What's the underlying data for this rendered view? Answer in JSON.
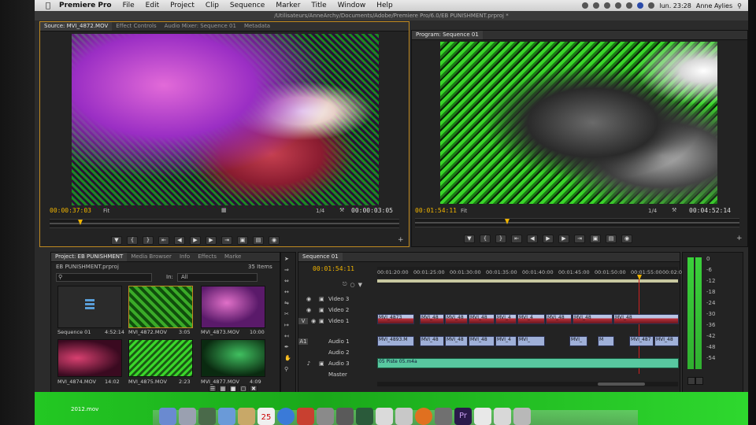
{
  "menubar": {
    "app": "Premiere Pro",
    "items": [
      "File",
      "Edit",
      "Project",
      "Clip",
      "Sequence",
      "Marker",
      "Title",
      "Window",
      "Help"
    ],
    "clock": "lun. 23:28",
    "user": "Anne Aylies"
  },
  "window_title": "/Utilisateurs/AnneArchy/Documents/Adobe/Premiere Pro/6.0/EB PUNISHMENT.prproj *",
  "source": {
    "tabs": [
      "Source: MVI_4872.MOV",
      "Effect Controls",
      "Audio Mixer: Sequence 01",
      "Metadata"
    ],
    "timecode_in": "00:00:37:03",
    "fit": "Fit",
    "res": "1/4",
    "timecode_dur": "00:00:03:05"
  },
  "program": {
    "tab": "Program: Sequence 01",
    "timecode_in": "00:01:54:11",
    "fit": "Fit",
    "res": "1/4",
    "timecode_dur": "00:04:52:14"
  },
  "project": {
    "tabs": [
      "Project: EB PUNISHMENT",
      "Media Browser",
      "Info",
      "Effects",
      "Marke"
    ],
    "file": "EB PUNISHMENT.prproj",
    "count": "35 Items",
    "in_label": "In:",
    "in_value": "All",
    "items": [
      {
        "name": "Sequence 01",
        "dur": "4:52:14"
      },
      {
        "name": "MVI_4872.MOV",
        "dur": "3:05"
      },
      {
        "name": "MVI_4873.MOV",
        "dur": "10:00"
      },
      {
        "name": "MVI_4874.MOV",
        "dur": "14:02"
      },
      {
        "name": "MVI_4875.MOV",
        "dur": "2:23"
      },
      {
        "name": "MVI_4877.MOV",
        "dur": "4:09"
      }
    ]
  },
  "timeline": {
    "tab": "Sequence 01",
    "timecode": "00:01:54:11",
    "ruler": [
      "00:01:20:00",
      "00:01:25:00",
      "00:01:30:00",
      "00:01:35:00",
      "00:01:40:00",
      "00:01:45:00",
      "00:01:50:00",
      "00:01:55:00",
      "00:02:00"
    ],
    "tracks": [
      "Video 3",
      "Video 2",
      "Video 1",
      "Audio 1",
      "Audio 2",
      "Audio 3",
      "Master"
    ],
    "v_label": "V",
    "a_label": "A1",
    "video_clips": [
      "MVI_4873",
      "MVI_48",
      "MVI_48",
      "MVI_48",
      "MVI_4",
      "MVI_4",
      "MVI_48",
      "MVI_48",
      "MVI_48"
    ],
    "audio_clips": [
      "MVI_4893.M",
      "MVI_48",
      "MVI_48",
      "MVI_48",
      "MVI_4",
      "MVI_",
      "MVI_",
      "M",
      "MVI_487",
      "MVI_48"
    ],
    "audio3_clip": "05 Piste 05.m4a"
  },
  "meter_ticks": [
    "0",
    "-6",
    "-12",
    "-18",
    "-24",
    "-30",
    "-36",
    "-42",
    "-48",
    "-54"
  ],
  "desktop": {
    "file": "2012.mov",
    "calendar_day": "25"
  }
}
